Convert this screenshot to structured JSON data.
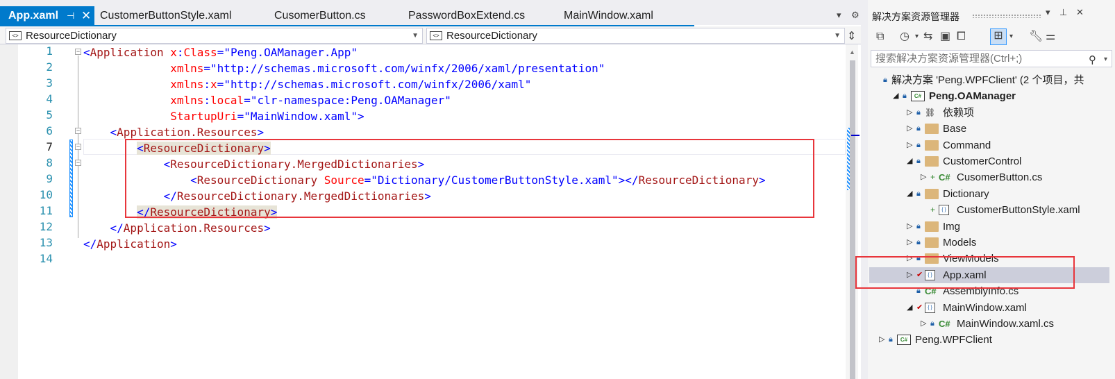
{
  "editor": {
    "tabs": [
      {
        "label": "App.xaml",
        "active": true
      },
      {
        "label": "CustomerButtonStyle.xaml"
      },
      {
        "label": "CusomerButton.cs"
      },
      {
        "label": "PasswordBoxExtend.cs"
      },
      {
        "label": "MainWindow.xaml"
      }
    ],
    "nav_left": "ResourceDictionary",
    "nav_right": "ResourceDictionary",
    "current_line": 7,
    "line_numbers": [
      "1",
      "2",
      "3",
      "4",
      "5",
      "6",
      "7",
      "8",
      "9",
      "10",
      "11",
      "12",
      "13",
      "14"
    ]
  },
  "code_lines": [
    [
      {
        "t": "<",
        "c": "br"
      },
      {
        "t": "Application",
        "c": "tag"
      },
      {
        "t": " x",
        "c": "attr"
      },
      {
        "t": ":",
        "c": "br"
      },
      {
        "t": "Class",
        "c": "attr"
      },
      {
        "t": "=",
        "c": "br"
      },
      {
        "t": "\"Peng.OAManager.App\"",
        "c": "val"
      }
    ],
    [
      {
        "t": "             xmlns",
        "c": "attr"
      },
      {
        "t": "=",
        "c": "br"
      },
      {
        "t": "\"http://schemas.microsoft.com/winfx/2006/xaml/presentation\"",
        "c": "val"
      }
    ],
    [
      {
        "t": "             xmlns",
        "c": "attr"
      },
      {
        "t": ":",
        "c": "br"
      },
      {
        "t": "x",
        "c": "attr"
      },
      {
        "t": "=",
        "c": "br"
      },
      {
        "t": "\"http://schemas.microsoft.com/winfx/2006/xaml\"",
        "c": "val"
      }
    ],
    [
      {
        "t": "             xmlns",
        "c": "attr"
      },
      {
        "t": ":",
        "c": "br"
      },
      {
        "t": "local",
        "c": "attr"
      },
      {
        "t": "=",
        "c": "br"
      },
      {
        "t": "\"clr-namespace:Peng.OAManager\"",
        "c": "val"
      }
    ],
    [
      {
        "t": "             StartupUri",
        "c": "attr"
      },
      {
        "t": "=",
        "c": "br"
      },
      {
        "t": "\"MainWindow.xaml\"",
        "c": "val"
      },
      {
        "t": ">",
        "c": "br"
      }
    ],
    [
      {
        "t": "    <",
        "c": "br"
      },
      {
        "t": "Application.Resources",
        "c": "tag"
      },
      {
        "t": ">",
        "c": "br"
      }
    ],
    [
      {
        "t": "        "
      },
      {
        "t": "<",
        "c": "br",
        "hl": true
      },
      {
        "t": "ResourceDictionary",
        "c": "tag",
        "hl": true
      },
      {
        "t": ">",
        "c": "br",
        "hl": true
      }
    ],
    [
      {
        "t": "            <",
        "c": "br"
      },
      {
        "t": "ResourceDictionary.MergedDictionaries",
        "c": "tag"
      },
      {
        "t": ">",
        "c": "br"
      }
    ],
    [
      {
        "t": "                <",
        "c": "br"
      },
      {
        "t": "ResourceDictionary",
        "c": "tag"
      },
      {
        "t": " Source",
        "c": "attr"
      },
      {
        "t": "=",
        "c": "br"
      },
      {
        "t": "\"Dictionary/CustomerButtonStyle.xaml\"",
        "c": "val"
      },
      {
        "t": "></",
        "c": "br"
      },
      {
        "t": "ResourceDictionary",
        "c": "tag"
      },
      {
        "t": ">",
        "c": "br"
      }
    ],
    [
      {
        "t": "            </",
        "c": "br"
      },
      {
        "t": "ResourceDictionary.MergedDictionaries",
        "c": "tag"
      },
      {
        "t": ">",
        "c": "br"
      }
    ],
    [
      {
        "t": "        "
      },
      {
        "t": "</",
        "c": "br",
        "hl": true
      },
      {
        "t": "ResourceDictionary",
        "c": "tag",
        "hl": true
      },
      {
        "t": ">",
        "c": "br",
        "hl": true
      }
    ],
    [
      {
        "t": "    </",
        "c": "br"
      },
      {
        "t": "Application.Resources",
        "c": "tag"
      },
      {
        "t": ">",
        "c": "br"
      }
    ],
    [
      {
        "t": "</",
        "c": "br"
      },
      {
        "t": "Application",
        "c": "tag"
      },
      {
        "t": ">",
        "c": "br"
      }
    ],
    []
  ],
  "solution_explorer": {
    "title": "解决方案资源管理器",
    "search_placeholder": "搜索解决方案资源管理器(Ctrl+;)",
    "tree": [
      {
        "label": "解决方案 'Peng.WPFClient' (2 个项目，共",
        "kind": "solution",
        "indent": 0
      },
      {
        "label": "Peng.OAManager",
        "kind": "project",
        "indent": 1,
        "bold": true,
        "expanded": true
      },
      {
        "label": "依赖项",
        "kind": "deps",
        "indent": 2,
        "collapsed": true
      },
      {
        "label": "Base",
        "kind": "folder",
        "indent": 2,
        "collapsed": true
      },
      {
        "label": "Command",
        "kind": "folder",
        "indent": 2,
        "collapsed": true
      },
      {
        "label": "CustomerControl",
        "kind": "folder",
        "indent": 2,
        "expanded": true
      },
      {
        "label": "CusomerButton.cs",
        "kind": "cs-new",
        "indent": 3,
        "collapsed": true
      },
      {
        "label": "Dictionary",
        "kind": "folder",
        "indent": 2,
        "expanded": true
      },
      {
        "label": "CustomerButtonStyle.xaml",
        "kind": "xaml-new",
        "indent": 3
      },
      {
        "label": "Img",
        "kind": "folder",
        "indent": 2,
        "collapsed": true
      },
      {
        "label": "Models",
        "kind": "folder",
        "indent": 2,
        "collapsed": true
      },
      {
        "label": "ViewModels",
        "kind": "folder",
        "indent": 2,
        "collapsed": true
      },
      {
        "label": "App.xaml",
        "kind": "xaml-modified",
        "indent": 2,
        "collapsed": true,
        "selected": true
      },
      {
        "label": "AssemblyInfo.cs",
        "kind": "cs",
        "indent": 2
      },
      {
        "label": "MainWindow.xaml",
        "kind": "xaml-modified",
        "indent": 2,
        "expanded": true
      },
      {
        "label": "MainWindow.xaml.cs",
        "kind": "cs",
        "indent": 3,
        "collapsed": true
      },
      {
        "label": "Peng.WPFClient",
        "kind": "project",
        "indent": 1,
        "collapsed": true,
        "rootlevel": true
      }
    ]
  }
}
